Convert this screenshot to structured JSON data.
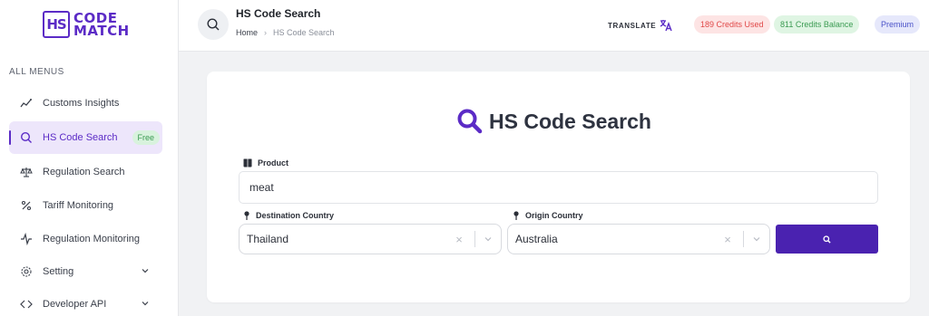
{
  "app": {
    "logo_mark": "HS",
    "logo_line1": "CODE",
    "logo_line2": "MATCH"
  },
  "sidebar": {
    "heading": "ALL MENUS",
    "items": [
      {
        "label": "Customs Insights",
        "icon": "trend-icon"
      },
      {
        "label": "HS Code Search",
        "icon": "search-icon",
        "badge": "Free",
        "active": true
      },
      {
        "label": "Regulation Search",
        "icon": "scale-icon"
      },
      {
        "label": "Tariff Monitoring",
        "icon": "percent-icon"
      },
      {
        "label": "Regulation Monitoring",
        "icon": "pulse-icon"
      },
      {
        "label": "Setting",
        "icon": "gear-icon",
        "expandable": true
      },
      {
        "label": "Developer API",
        "icon": "code-icon",
        "expandable": true
      }
    ]
  },
  "header": {
    "title": "HS Code Search",
    "breadcrumb": {
      "home": "Home",
      "current": "HS Code Search"
    },
    "translate_label": "TRANSLATE",
    "credits_used": "189 Credits Used",
    "credits_balance": "811 Credits Balance",
    "plan": "Premium"
  },
  "form": {
    "title": "HS Code Search",
    "product_label": "Product",
    "product_value": "meat",
    "destination_label": "Destination Country",
    "destination_value": "Thailand",
    "origin_label": "Origin Country",
    "origin_value": "Australia",
    "clear_glyph": "×"
  },
  "colors": {
    "brand": "#5b2bc6",
    "button": "#4a22b0",
    "used": "#e04848",
    "balance": "#3b9b52",
    "premium": "#4a52c8"
  }
}
